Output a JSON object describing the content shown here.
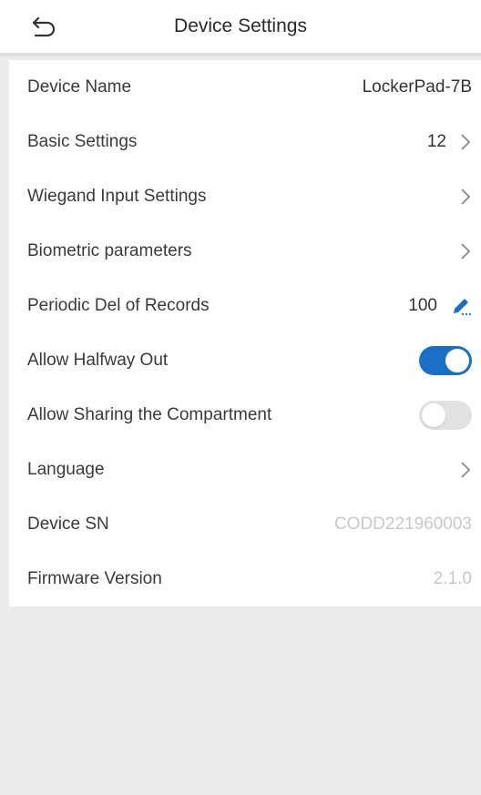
{
  "header": {
    "title": "Device Settings",
    "back_icon": "back-arrow-icon"
  },
  "settings": {
    "device_name": {
      "label": "Device Name",
      "value": "LockerPad-7B"
    },
    "basic_settings": {
      "label": "Basic Settings",
      "value": "12",
      "icon": "chevron-right-icon"
    },
    "wiegand": {
      "label": "Wiegand Input Settings",
      "icon": "chevron-right-icon"
    },
    "biometric": {
      "label": "Biometric parameters",
      "icon": "chevron-right-icon"
    },
    "periodic_del": {
      "label": "Periodic Del of Records",
      "value": "100",
      "icon": "edit-pencil-icon"
    },
    "halfway_out": {
      "label": "Allow Halfway Out",
      "toggle_on": true
    },
    "sharing": {
      "label": "Allow Sharing the Compartment",
      "toggle_on": false
    },
    "language": {
      "label": "Language",
      "icon": "chevron-right-icon"
    },
    "device_sn": {
      "label": "Device SN",
      "value": "CODD221960003"
    },
    "firmware": {
      "label": "Firmware Version",
      "value": "2.1.0"
    }
  },
  "colors": {
    "accent": "#1a6fc5",
    "background": "#ececec",
    "muted_text": "#c8c8c8"
  }
}
